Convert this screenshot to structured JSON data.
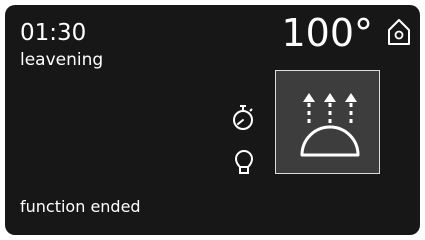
{
  "status_bar": {
    "time": "01:30",
    "mode": "leavening",
    "temperature": "100°"
  },
  "function_panel": {
    "icon": "leavening-function-icon"
  },
  "side_controls": {
    "timer_icon": "timer-icon",
    "light_icon": "light-bulb-icon"
  },
  "footer": {
    "status": "function ended"
  },
  "icons": {
    "home": "home-icon"
  },
  "colors": {
    "screen_background": "#171717",
    "panel_background": "#3d3d3d",
    "panel_border": "#dcdcdc",
    "text": "#ffffff"
  }
}
